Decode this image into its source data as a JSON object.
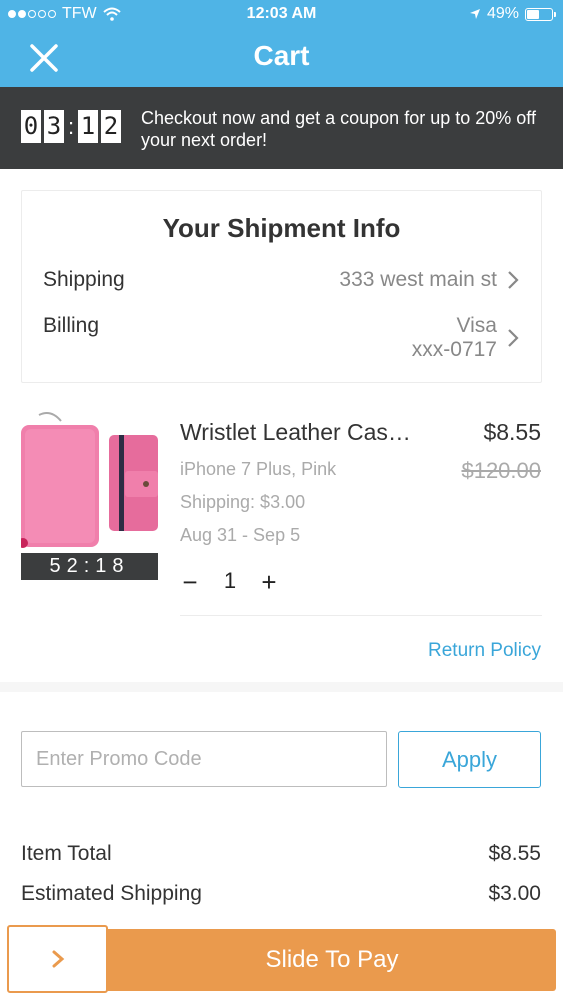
{
  "status_bar": {
    "carrier": "TFW",
    "time": "12:03 AM",
    "battery": "49%"
  },
  "nav": {
    "title": "Cart",
    "close_icon": "close-icon"
  },
  "banner": {
    "timer_digits": [
      "0",
      "3",
      "1",
      "2"
    ],
    "message": "Checkout now and get a coupon for up to 20% off your next order!"
  },
  "shipment": {
    "title": "Your Shipment Info",
    "shipping_label": "Shipping",
    "shipping_value": "333 west main st",
    "billing_label": "Billing",
    "billing_value_line1": "Visa",
    "billing_value_line2": "xxx-0717"
  },
  "product": {
    "name": "Wristlet Leather Cas…",
    "price": "$8.55",
    "original_price": "$120.00",
    "variant": "iPhone 7 Plus, Pink",
    "shipping": "Shipping: $3.00",
    "delivery": "Aug 31 - Sep 5",
    "timer": "52:18",
    "quantity": "1",
    "minus_label": "−",
    "plus_label": "+"
  },
  "return_policy": "Return Policy",
  "promo": {
    "placeholder": "Enter Promo Code",
    "apply_label": "Apply"
  },
  "totals": {
    "item_total_label": "Item Total",
    "item_total_value": "$8.55",
    "est_shipping_label": "Estimated Shipping",
    "est_shipping_value": "$3.00"
  },
  "pay": {
    "label": "Slide To Pay"
  },
  "colors": {
    "header": "#4fb4e6",
    "banner": "#3b3d3e",
    "accent": "#3aa6d9",
    "pay": "#ea9a4d"
  }
}
